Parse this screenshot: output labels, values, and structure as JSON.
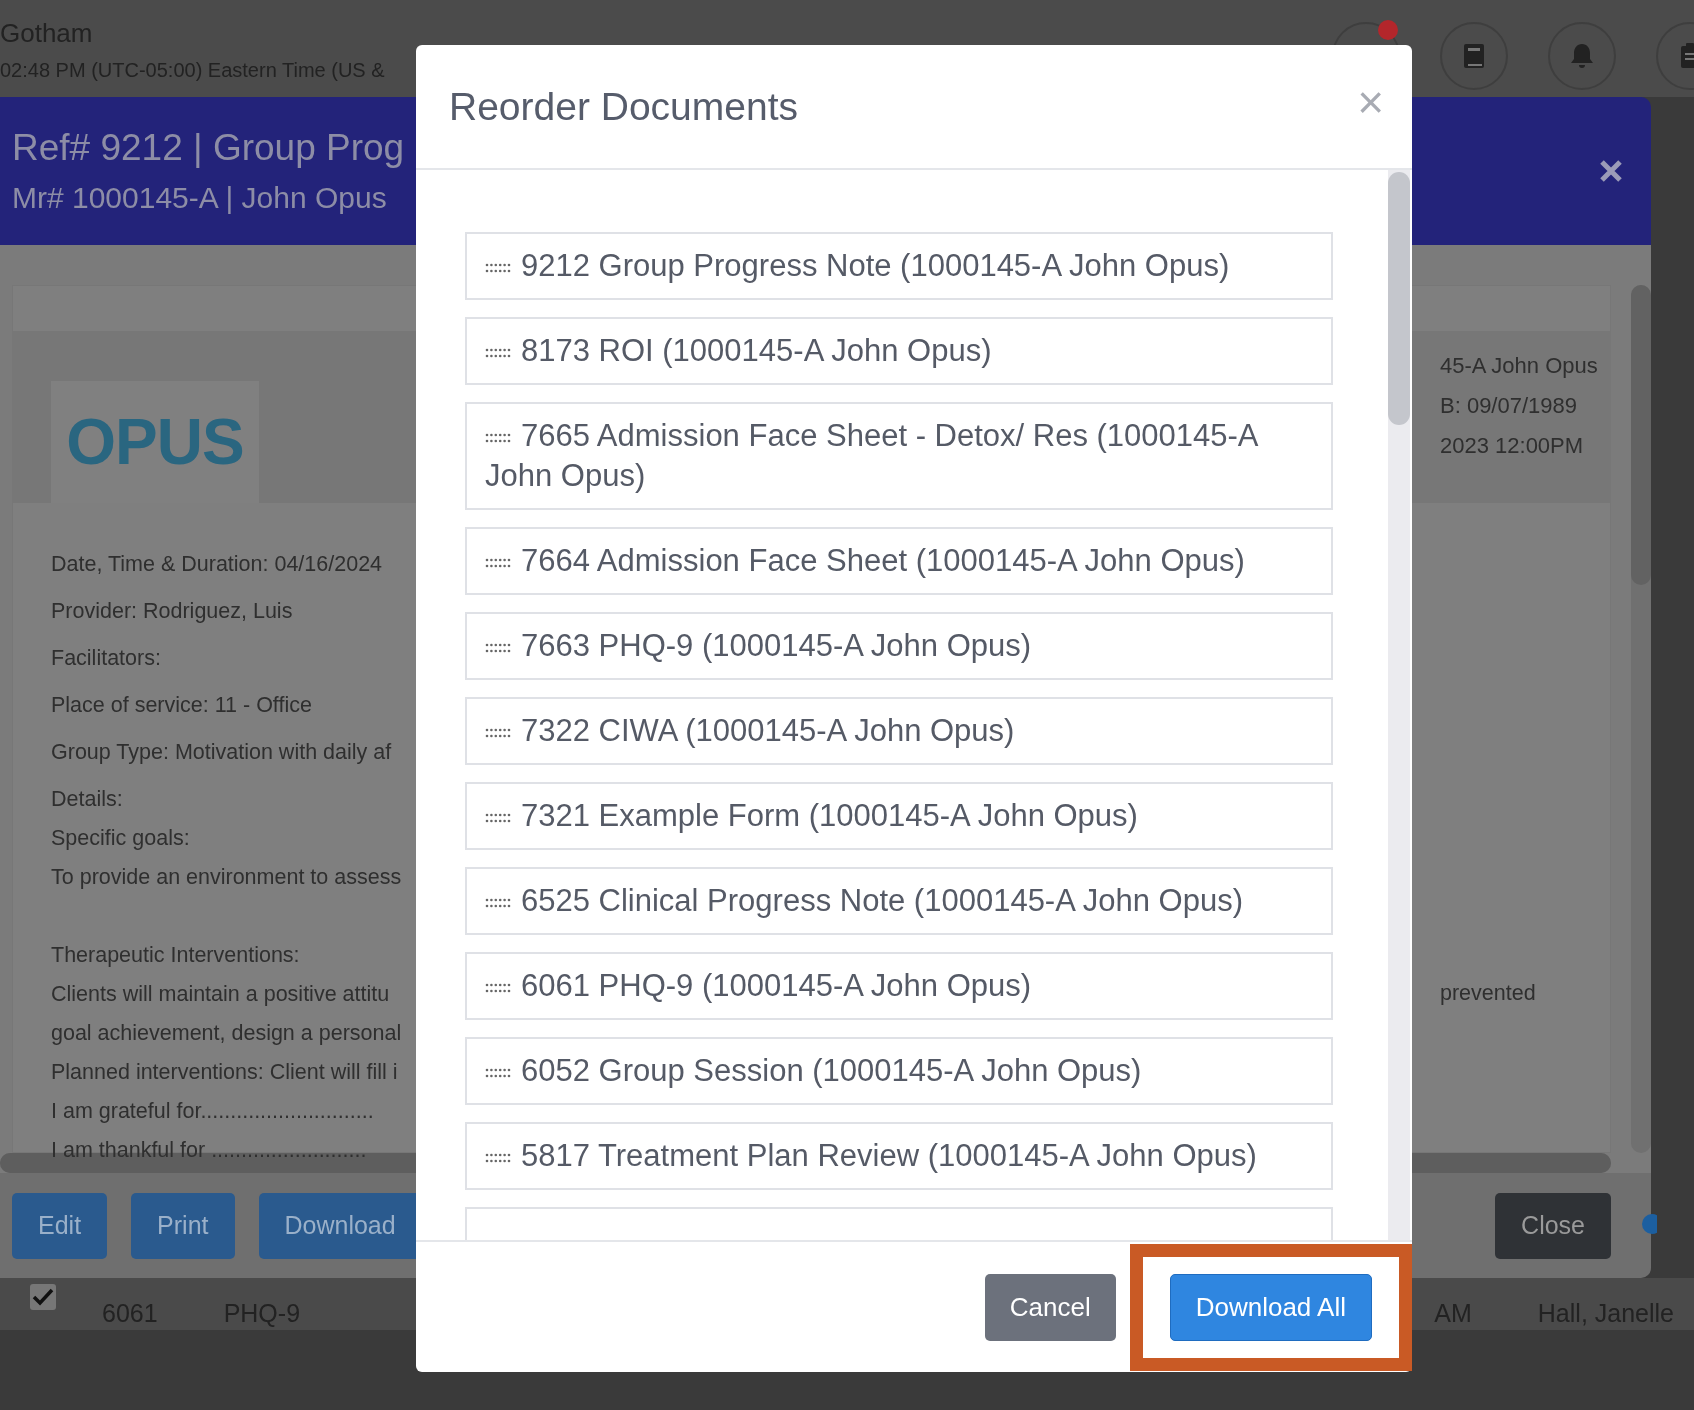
{
  "top_bar": {
    "location": "Gotham",
    "time": "02:48 PM (UTC-05:00) Eastern Time (US &",
    "chat_unread": true
  },
  "header": {
    "title": "Ref# 9212 | Group Prog",
    "subtitle": "Mr# 1000145-A | John Opus"
  },
  "document": {
    "logo": "OPUS",
    "sections": [
      [
        "Date, Time & Duration:  04/16/2024"
      ],
      [
        "Provider: Rodriguez, Luis"
      ],
      [
        "Facilitators:"
      ],
      [
        "Place of service: 11 - Office"
      ],
      [
        "Group Type:  Motivation with daily af"
      ],
      [
        "Details:",
        "Specific goals:",
        "To provide an environment to assess"
      ],
      [
        "Therapeutic Interventions:",
        "Clients will maintain a positive attitu",
        "goal achievement, design a personal",
        "Planned interventions: Client will fill i",
        "I am grateful for.............................",
        "I am thankful for .........................."
      ]
    ],
    "right_lines": [
      "45-A John Opus",
      "B: 09/07/1989",
      "2023 12:00PM"
    ],
    "right_note": "prevented"
  },
  "footer_buttons": [
    {
      "label": "Edit",
      "kind": "primary"
    },
    {
      "label": "Print",
      "kind": "primary"
    },
    {
      "label": "Download",
      "kind": "primary"
    },
    {
      "label": "Close",
      "kind": "dark"
    }
  ],
  "table_row": {
    "checked": true,
    "cells": [
      "6061",
      "PHQ-9"
    ],
    "right_cells": [
      "AM",
      "Hall, Janelle"
    ]
  },
  "modal": {
    "title": "Reorder Documents",
    "close": "×",
    "documents": [
      "9212 Group Progress Note (1000145-A John Opus)",
      "8173 ROI (1000145-A John Opus)",
      "7665 Admission Face Sheet - Detox/ Res (1000145-A John Opus)",
      "7664 Admission Face Sheet (1000145-A John Opus)",
      "7663 PHQ-9 (1000145-A John Opus)",
      "7322 CIWA (1000145-A John Opus)",
      "7321 Example Form (1000145-A John Opus)",
      "6525 Clinical Progress Note (1000145-A John Opus)",
      "6061 PHQ-9 (1000145-A John Opus)",
      "6052 Group Session (1000145-A John Opus)",
      "5817 Treatment Plan Review (1000145-A John Opus)"
    ],
    "buttons": [
      {
        "label": "Cancel",
        "kind": "secondary",
        "highlighted": false
      },
      {
        "label": "Download All",
        "kind": "primary",
        "highlighted": true
      }
    ]
  }
}
